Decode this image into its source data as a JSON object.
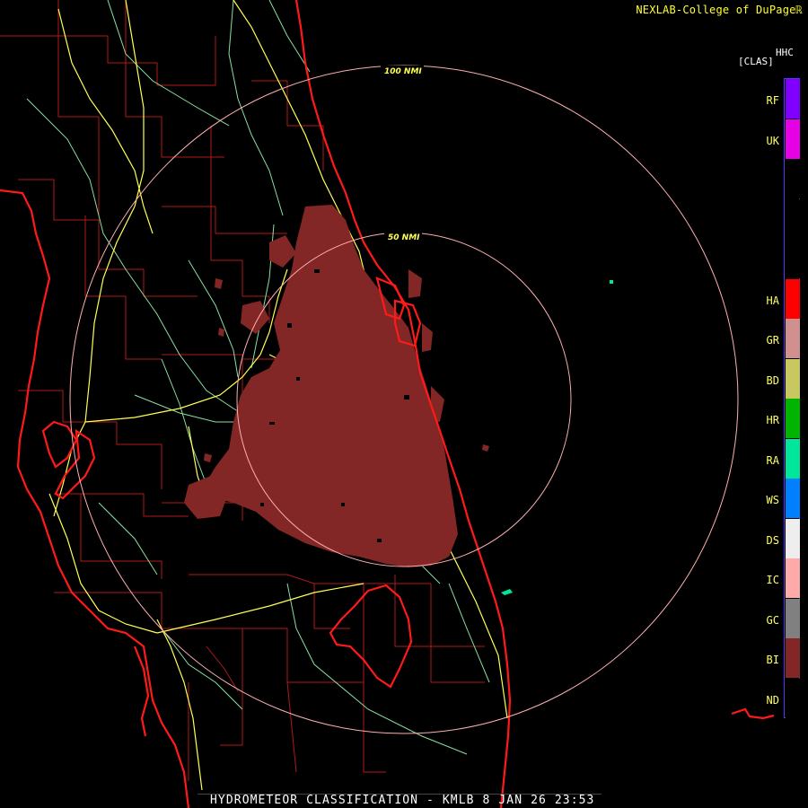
{
  "credit": "NEXLAB-College of DuPage",
  "credit_logo": "ℝ",
  "legend": {
    "title": "HHC",
    "subtitle": "[CLAS]",
    "border_color": "#5a32ff",
    "classes": [
      {
        "code": "RF",
        "color": "#7f00ff"
      },
      {
        "code": "UK",
        "color": "#e600e6"
      },
      {
        "code": "",
        "color": "#000000"
      },
      {
        "code": "",
        "color": "#000000"
      },
      {
        "code": "",
        "color": "#000000"
      },
      {
        "code": "HA",
        "color": "#ff0000"
      },
      {
        "code": "GR",
        "color": "#d09090"
      },
      {
        "code": "BD",
        "color": "#c8c860"
      },
      {
        "code": "HR",
        "color": "#00b400"
      },
      {
        "code": "RA",
        "color": "#00e69a"
      },
      {
        "code": "WS",
        "color": "#0080ff"
      },
      {
        "code": "DS",
        "color": "#eeeeee"
      },
      {
        "code": "IC",
        "color": "#ffaaaa"
      },
      {
        "code": "GC",
        "color": "#808080"
      },
      {
        "code": "BI",
        "color": "#822626"
      },
      {
        "code": "ND",
        "color": "#000000"
      }
    ]
  },
  "range_rings": [
    {
      "label": "100 NMI",
      "nmi": 100
    },
    {
      "label": "50 NMI",
      "nmi": 50
    }
  ],
  "footer": "HYDROMETEOR CLASSIFICATION - KMLB 8 JAN 26 23:53",
  "colors": {
    "coast": "#ff1a1a",
    "county": "#b01a1a",
    "highway_primary": "#ffff55",
    "highway_secondary": "#88e0a0",
    "ring": "#ffb0b0",
    "echo_bi": "#822626"
  }
}
